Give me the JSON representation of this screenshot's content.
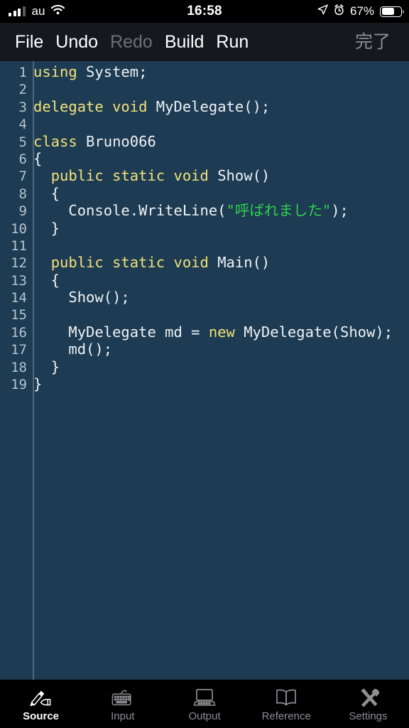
{
  "status_bar": {
    "carrier": "au",
    "time": "16:58",
    "battery_percent": "67%",
    "battery_level": 67,
    "icons": [
      "signal-bars-icon",
      "wifi-icon",
      "location-arrow-icon",
      "alarm-clock-icon",
      "battery-icon"
    ]
  },
  "toolbar": {
    "file_label": "File",
    "undo_label": "Undo",
    "redo_label": "Redo",
    "build_label": "Build",
    "run_label": "Run",
    "done_label": "完了"
  },
  "editor": {
    "language": "csharp",
    "colors": {
      "background": "#1d3b52",
      "keyword": "#f2e27a",
      "string": "#2fd14f",
      "text": "#eef2f5",
      "line_number": "#b4c4cf",
      "gutter_rule": "#4d6a80"
    },
    "lines": [
      {
        "n": "1",
        "tokens": [
          {
            "t": "using",
            "c": "kw"
          },
          {
            "t": " System;",
            "c": "src"
          }
        ]
      },
      {
        "n": "2",
        "tokens": []
      },
      {
        "n": "3",
        "tokens": [
          {
            "t": "delegate",
            "c": "kw"
          },
          {
            "t": " ",
            "c": "src"
          },
          {
            "t": "void",
            "c": "kw"
          },
          {
            "t": " MyDelegate();",
            "c": "src"
          }
        ]
      },
      {
        "n": "4",
        "tokens": []
      },
      {
        "n": "5",
        "tokens": [
          {
            "t": "class",
            "c": "kw"
          },
          {
            "t": " Bruno066",
            "c": "src"
          }
        ]
      },
      {
        "n": "6",
        "tokens": [
          {
            "t": "{",
            "c": "src"
          }
        ]
      },
      {
        "n": "7",
        "tokens": [
          {
            "t": "  ",
            "c": "src"
          },
          {
            "t": "public",
            "c": "kw"
          },
          {
            "t": " ",
            "c": "src"
          },
          {
            "t": "static",
            "c": "kw"
          },
          {
            "t": " ",
            "c": "src"
          },
          {
            "t": "void",
            "c": "kw"
          },
          {
            "t": " Show()",
            "c": "src"
          }
        ]
      },
      {
        "n": "8",
        "tokens": [
          {
            "t": "  {",
            "c": "src"
          }
        ]
      },
      {
        "n": "9",
        "tokens": [
          {
            "t": "    Console.WriteLine(",
            "c": "src"
          },
          {
            "t": "\"呼ばれました\"",
            "c": "str"
          },
          {
            "t": ");",
            "c": "src"
          }
        ]
      },
      {
        "n": "10",
        "tokens": [
          {
            "t": "  }",
            "c": "src"
          }
        ]
      },
      {
        "n": "11",
        "tokens": []
      },
      {
        "n": "12",
        "tokens": [
          {
            "t": "  ",
            "c": "src"
          },
          {
            "t": "public",
            "c": "kw"
          },
          {
            "t": " ",
            "c": "src"
          },
          {
            "t": "static",
            "c": "kw"
          },
          {
            "t": " ",
            "c": "src"
          },
          {
            "t": "void",
            "c": "kw"
          },
          {
            "t": " Main()",
            "c": "src"
          }
        ]
      },
      {
        "n": "13",
        "tokens": [
          {
            "t": "  {",
            "c": "src"
          }
        ]
      },
      {
        "n": "14",
        "tokens": [
          {
            "t": "    Show();",
            "c": "src"
          }
        ]
      },
      {
        "n": "15",
        "tokens": []
      },
      {
        "n": "16",
        "tokens": [
          {
            "t": "    MyDelegate md = ",
            "c": "src"
          },
          {
            "t": "new",
            "c": "kw"
          },
          {
            "t": " MyDelegate(Show);",
            "c": "src"
          }
        ]
      },
      {
        "n": "17",
        "tokens": [
          {
            "t": "    md();",
            "c": "src"
          }
        ]
      },
      {
        "n": "18",
        "tokens": [
          {
            "t": "  }",
            "c": "src"
          }
        ]
      },
      {
        "n": "19",
        "tokens": [
          {
            "t": "}",
            "c": "src"
          }
        ]
      }
    ]
  },
  "tabbar": {
    "active_index": 0,
    "items": [
      {
        "label": "Source",
        "icon": "hand-writing-pen-icon"
      },
      {
        "label": "Input",
        "icon": "keyboard-icon"
      },
      {
        "label": "Output",
        "icon": "computer-monitor-icon"
      },
      {
        "label": "Reference",
        "icon": "open-book-icon"
      },
      {
        "label": "Settings",
        "icon": "hammer-wrench-icon"
      }
    ]
  }
}
